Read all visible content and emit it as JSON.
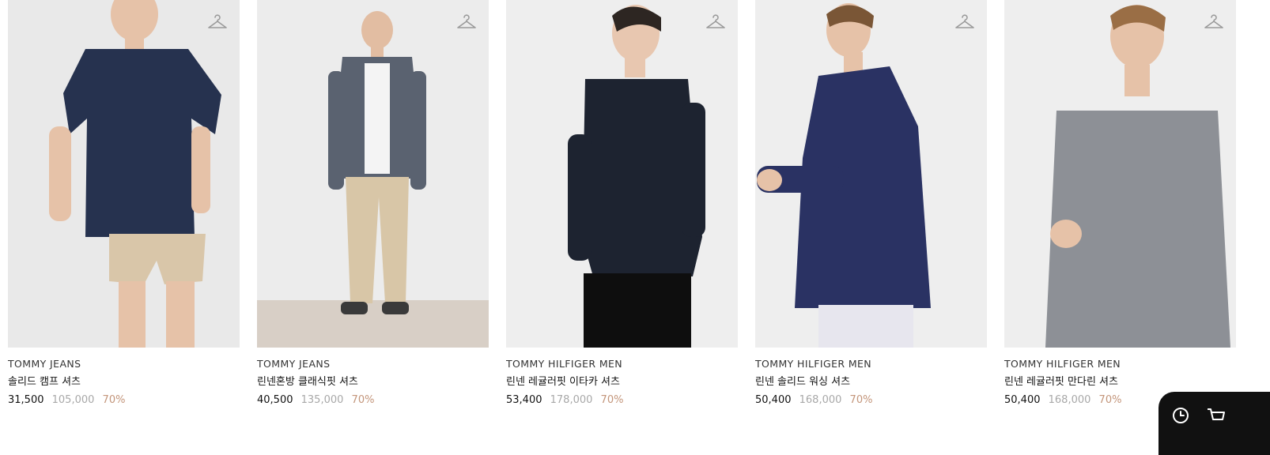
{
  "products": [
    {
      "brand": "TOMMY JEANS",
      "name": "솔리드 캠프 셔츠",
      "sale_price": "31,500",
      "original_price": "105,000",
      "discount": "70%",
      "bg": "#e9e9e9",
      "shirt_color": "#26324f",
      "pants_color": "#d9c6a9"
    },
    {
      "brand": "TOMMY JEANS",
      "name": "린넨혼방 클래식핏 셔츠",
      "sale_price": "40,500",
      "original_price": "135,000",
      "discount": "70%",
      "bg": "#ececec",
      "shirt_color": "#5a6270",
      "pants_color": "#d8c6a7"
    },
    {
      "brand": "TOMMY HILFIGER MEN",
      "name": "린넨 레귤러핏 이타카 셔츠",
      "sale_price": "53,400",
      "original_price": "178,000",
      "discount": "70%",
      "bg": "#eeeeee",
      "shirt_color": "#1d2330",
      "pants_color": "#0e0e0e"
    },
    {
      "brand": "TOMMY HILFIGER MEN",
      "name": "린넨 솔리드 워싱 셔츠",
      "sale_price": "50,400",
      "original_price": "168,000",
      "discount": "70%",
      "bg": "#eeeeee",
      "shirt_color": "#2a3263",
      "pants_color": "#e7e6ee"
    },
    {
      "brand": "TOMMY HILFIGER MEN",
      "name": "린넨 레귤러핏 만다린 셔츠",
      "sale_price": "50,400",
      "original_price": "168,000",
      "discount": "70%",
      "bg": "#eeeeee",
      "shirt_color": "#8d9096",
      "pants_color": "#eeeeee"
    }
  ],
  "icons": {
    "wishlist": "hanger-icon",
    "recent": "clock-icon",
    "cart": "cart-icon"
  }
}
